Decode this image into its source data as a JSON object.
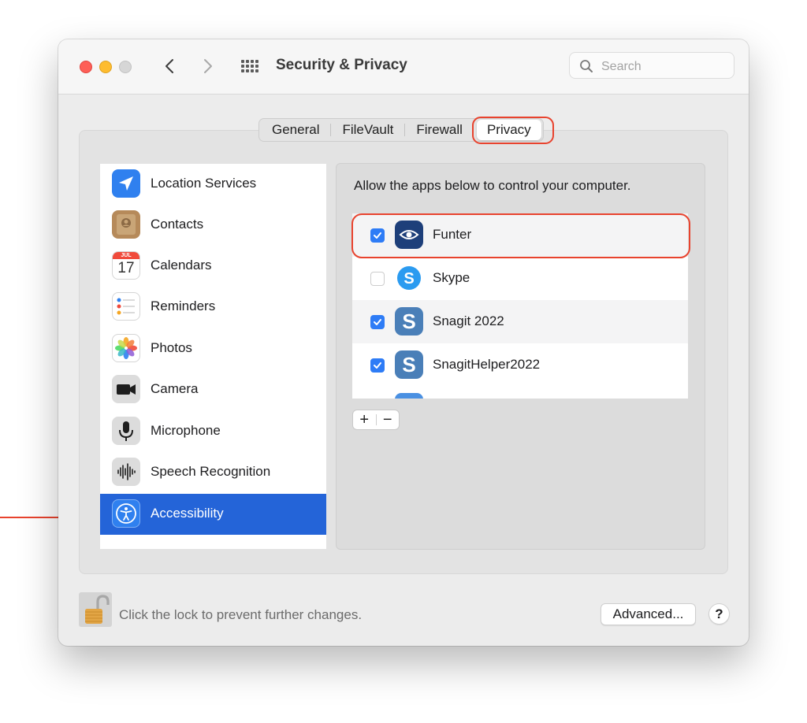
{
  "window": {
    "title": "Security & Privacy",
    "search_placeholder": "Search"
  },
  "tabs": [
    {
      "label": "General"
    },
    {
      "label": "FileVault"
    },
    {
      "label": "Firewall"
    },
    {
      "label": "Privacy",
      "selected": true
    }
  ],
  "sidebar": {
    "items": [
      {
        "label": "Location Services",
        "icon": "location-arrow-icon"
      },
      {
        "label": "Contacts",
        "icon": "contacts-book-icon"
      },
      {
        "label": "Calendars",
        "icon": "calendar-icon",
        "calendar_month": "JUL",
        "calendar_day": "17"
      },
      {
        "label": "Reminders",
        "icon": "reminders-list-icon"
      },
      {
        "label": "Photos",
        "icon": "photos-flower-icon"
      },
      {
        "label": "Camera",
        "icon": "camera-icon"
      },
      {
        "label": "Microphone",
        "icon": "microphone-icon"
      },
      {
        "label": "Speech Recognition",
        "icon": "waveform-icon"
      },
      {
        "label": "Accessibility",
        "icon": "accessibility-icon",
        "selected": true
      }
    ]
  },
  "detail": {
    "description": "Allow the apps below to control your computer.",
    "apps": [
      {
        "name": "Funter",
        "checked": true,
        "icon": "eye-icon"
      },
      {
        "name": "Skype",
        "checked": false,
        "icon": "skype-icon"
      },
      {
        "name": "Snagit 2022",
        "checked": true,
        "icon": "snagit-icon"
      },
      {
        "name": "SnagitHelper2022",
        "checked": true,
        "icon": "snagit-helper-icon"
      }
    ],
    "add_label": "+",
    "remove_label": "−"
  },
  "footer": {
    "lock_text": "Click the lock to prevent further changes.",
    "advanced_label": "Advanced...",
    "help_label": "?"
  },
  "colors": {
    "selection": "#2464d8",
    "checkbox": "#2e7cf6",
    "annotation": "#e8432e"
  }
}
